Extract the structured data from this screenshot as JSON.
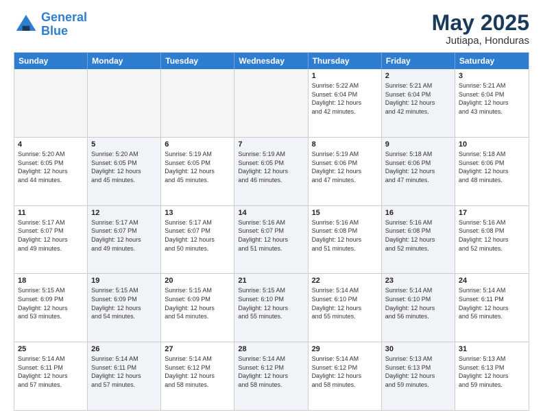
{
  "logo": {
    "line1": "General",
    "line2": "Blue"
  },
  "title": {
    "month_year": "May 2025",
    "location": "Jutiapa, Honduras"
  },
  "days_of_week": [
    "Sunday",
    "Monday",
    "Tuesday",
    "Wednesday",
    "Thursday",
    "Friday",
    "Saturday"
  ],
  "weeks": [
    [
      {
        "day": "",
        "info": "",
        "shaded": false,
        "empty": true
      },
      {
        "day": "",
        "info": "",
        "shaded": false,
        "empty": true
      },
      {
        "day": "",
        "info": "",
        "shaded": false,
        "empty": true
      },
      {
        "day": "",
        "info": "",
        "shaded": false,
        "empty": true
      },
      {
        "day": "1",
        "info": "Sunrise: 5:22 AM\nSunset: 6:04 PM\nDaylight: 12 hours\nand 42 minutes.",
        "shaded": false,
        "empty": false
      },
      {
        "day": "2",
        "info": "Sunrise: 5:21 AM\nSunset: 6:04 PM\nDaylight: 12 hours\nand 42 minutes.",
        "shaded": true,
        "empty": false
      },
      {
        "day": "3",
        "info": "Sunrise: 5:21 AM\nSunset: 6:04 PM\nDaylight: 12 hours\nand 43 minutes.",
        "shaded": false,
        "empty": false
      }
    ],
    [
      {
        "day": "4",
        "info": "Sunrise: 5:20 AM\nSunset: 6:05 PM\nDaylight: 12 hours\nand 44 minutes.",
        "shaded": false,
        "empty": false
      },
      {
        "day": "5",
        "info": "Sunrise: 5:20 AM\nSunset: 6:05 PM\nDaylight: 12 hours\nand 45 minutes.",
        "shaded": true,
        "empty": false
      },
      {
        "day": "6",
        "info": "Sunrise: 5:19 AM\nSunset: 6:05 PM\nDaylight: 12 hours\nand 45 minutes.",
        "shaded": false,
        "empty": false
      },
      {
        "day": "7",
        "info": "Sunrise: 5:19 AM\nSunset: 6:05 PM\nDaylight: 12 hours\nand 46 minutes.",
        "shaded": true,
        "empty": false
      },
      {
        "day": "8",
        "info": "Sunrise: 5:19 AM\nSunset: 6:06 PM\nDaylight: 12 hours\nand 47 minutes.",
        "shaded": false,
        "empty": false
      },
      {
        "day": "9",
        "info": "Sunrise: 5:18 AM\nSunset: 6:06 PM\nDaylight: 12 hours\nand 47 minutes.",
        "shaded": true,
        "empty": false
      },
      {
        "day": "10",
        "info": "Sunrise: 5:18 AM\nSunset: 6:06 PM\nDaylight: 12 hours\nand 48 minutes.",
        "shaded": false,
        "empty": false
      }
    ],
    [
      {
        "day": "11",
        "info": "Sunrise: 5:17 AM\nSunset: 6:07 PM\nDaylight: 12 hours\nand 49 minutes.",
        "shaded": false,
        "empty": false
      },
      {
        "day": "12",
        "info": "Sunrise: 5:17 AM\nSunset: 6:07 PM\nDaylight: 12 hours\nand 49 minutes.",
        "shaded": true,
        "empty": false
      },
      {
        "day": "13",
        "info": "Sunrise: 5:17 AM\nSunset: 6:07 PM\nDaylight: 12 hours\nand 50 minutes.",
        "shaded": false,
        "empty": false
      },
      {
        "day": "14",
        "info": "Sunrise: 5:16 AM\nSunset: 6:07 PM\nDaylight: 12 hours\nand 51 minutes.",
        "shaded": true,
        "empty": false
      },
      {
        "day": "15",
        "info": "Sunrise: 5:16 AM\nSunset: 6:08 PM\nDaylight: 12 hours\nand 51 minutes.",
        "shaded": false,
        "empty": false
      },
      {
        "day": "16",
        "info": "Sunrise: 5:16 AM\nSunset: 6:08 PM\nDaylight: 12 hours\nand 52 minutes.",
        "shaded": true,
        "empty": false
      },
      {
        "day": "17",
        "info": "Sunrise: 5:16 AM\nSunset: 6:08 PM\nDaylight: 12 hours\nand 52 minutes.",
        "shaded": false,
        "empty": false
      }
    ],
    [
      {
        "day": "18",
        "info": "Sunrise: 5:15 AM\nSunset: 6:09 PM\nDaylight: 12 hours\nand 53 minutes.",
        "shaded": false,
        "empty": false
      },
      {
        "day": "19",
        "info": "Sunrise: 5:15 AM\nSunset: 6:09 PM\nDaylight: 12 hours\nand 54 minutes.",
        "shaded": true,
        "empty": false
      },
      {
        "day": "20",
        "info": "Sunrise: 5:15 AM\nSunset: 6:09 PM\nDaylight: 12 hours\nand 54 minutes.",
        "shaded": false,
        "empty": false
      },
      {
        "day": "21",
        "info": "Sunrise: 5:15 AM\nSunset: 6:10 PM\nDaylight: 12 hours\nand 55 minutes.",
        "shaded": true,
        "empty": false
      },
      {
        "day": "22",
        "info": "Sunrise: 5:14 AM\nSunset: 6:10 PM\nDaylight: 12 hours\nand 55 minutes.",
        "shaded": false,
        "empty": false
      },
      {
        "day": "23",
        "info": "Sunrise: 5:14 AM\nSunset: 6:10 PM\nDaylight: 12 hours\nand 56 minutes.",
        "shaded": true,
        "empty": false
      },
      {
        "day": "24",
        "info": "Sunrise: 5:14 AM\nSunset: 6:11 PM\nDaylight: 12 hours\nand 56 minutes.",
        "shaded": false,
        "empty": false
      }
    ],
    [
      {
        "day": "25",
        "info": "Sunrise: 5:14 AM\nSunset: 6:11 PM\nDaylight: 12 hours\nand 57 minutes.",
        "shaded": false,
        "empty": false
      },
      {
        "day": "26",
        "info": "Sunrise: 5:14 AM\nSunset: 6:11 PM\nDaylight: 12 hours\nand 57 minutes.",
        "shaded": true,
        "empty": false
      },
      {
        "day": "27",
        "info": "Sunrise: 5:14 AM\nSunset: 6:12 PM\nDaylight: 12 hours\nand 58 minutes.",
        "shaded": false,
        "empty": false
      },
      {
        "day": "28",
        "info": "Sunrise: 5:14 AM\nSunset: 6:12 PM\nDaylight: 12 hours\nand 58 minutes.",
        "shaded": true,
        "empty": false
      },
      {
        "day": "29",
        "info": "Sunrise: 5:14 AM\nSunset: 6:12 PM\nDaylight: 12 hours\nand 58 minutes.",
        "shaded": false,
        "empty": false
      },
      {
        "day": "30",
        "info": "Sunrise: 5:13 AM\nSunset: 6:13 PM\nDaylight: 12 hours\nand 59 minutes.",
        "shaded": true,
        "empty": false
      },
      {
        "day": "31",
        "info": "Sunrise: 5:13 AM\nSunset: 6:13 PM\nDaylight: 12 hours\nand 59 minutes.",
        "shaded": false,
        "empty": false
      }
    ]
  ]
}
